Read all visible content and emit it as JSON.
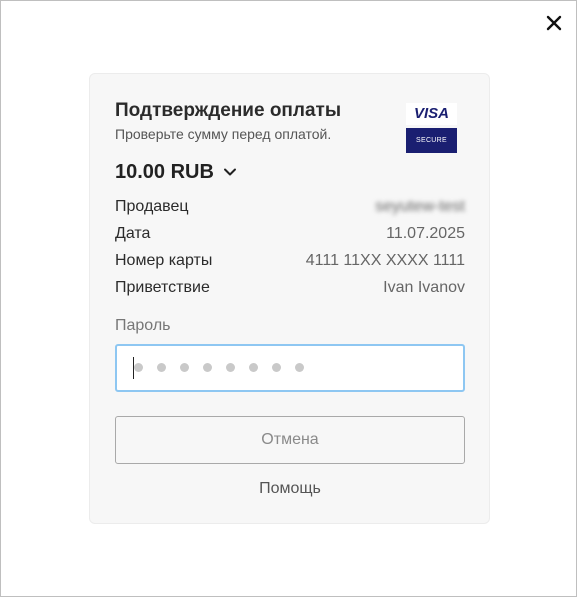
{
  "dialog": {
    "close_icon": "close-icon",
    "title": "Подтверждение оплаты",
    "subtitle": "Проверьте сумму перед оплатой.",
    "brand": {
      "name": "VISA",
      "badge": "SECURE",
      "color": "#1a1f71"
    },
    "amount": "10.00 RUB",
    "details": [
      {
        "label": "Продавец",
        "value": "seyutew-test"
      },
      {
        "label": "Дата",
        "value": "11.07.2025"
      },
      {
        "label": "Номер карты",
        "value": "4111 11XX XXXX 1111"
      },
      {
        "label": "Приветствие",
        "value": "Ivan Ivanov"
      }
    ],
    "password": {
      "label": "Пароль",
      "placeholder": "••••••••"
    },
    "cancel_label": "Отмена",
    "help_label": "Помощь"
  }
}
